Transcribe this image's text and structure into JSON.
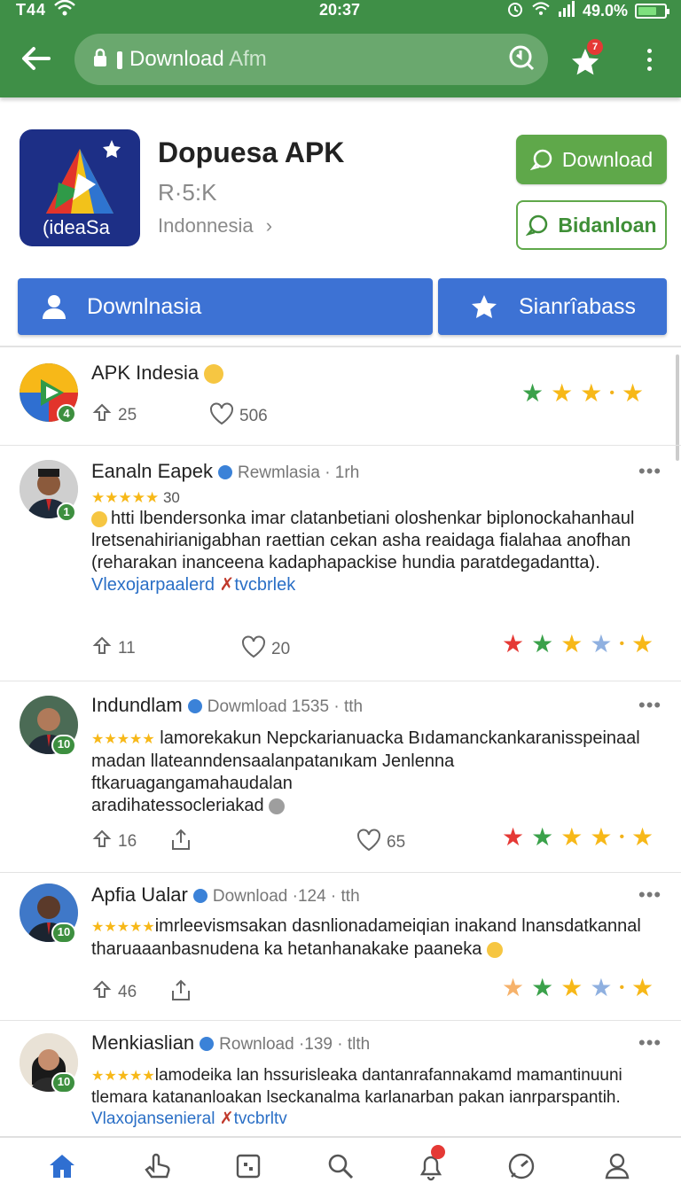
{
  "status": {
    "carrier": "T44",
    "time": "20:37",
    "battery": "49.0%"
  },
  "browser": {
    "url_main": "Download",
    "url_dim": " Afm",
    "notification_badge": "7"
  },
  "app": {
    "name": "Dopuesa APK",
    "size": "R·5:K",
    "region": "Indonnesia",
    "icon_text": "(ideaSa",
    "download_label": "Download",
    "secondary_label": "Bidanloan"
  },
  "actions": {
    "primary_label": "Downlnasia",
    "secondary_label": "Sianrîabass"
  },
  "feed": {
    "top": {
      "title": "APK Indesia",
      "shares": "25",
      "likes": "506",
      "level": "4"
    },
    "posts": [
      {
        "name": "Eanaln Eapek",
        "meta": "Rewmlasia · 1rh",
        "stars_text": "★★★★★",
        "rating_count": "30",
        "lines": [
          "htti lbendersonka imar clatanbetiani oloshenkar biplonockahanhaul",
          "lretsenahirianigabhan raettian cekan asha reaidaga fialahaa anofhan",
          "(reharakan inanceena kadaphapackise hundia paratdegadantta)."
        ],
        "link": "Vlexojarpaalerd",
        "tag": "tvcbrlek",
        "shares": "11",
        "likes": "20",
        "level": "1"
      },
      {
        "name": "Indundlam",
        "meta": "Dowmload 1535 · tth",
        "stars_text": "★★★★★",
        "lines": [
          "lamorekakun Nepckarianuacka Bıdamanckankaranisspeinaal",
          "madan llateanndensaalanpatanıkam Jenlenna ftkaruagangamahaudalan",
          "aradihatessocleriakad"
        ],
        "shares": "16",
        "likes": "65",
        "level": "10"
      },
      {
        "name": "Apfia Ualar",
        "meta": "Download ·124 · tth",
        "stars_text": "★★★★★",
        "lines": [
          "imrleevismsakan dasnlionadameiqian inakand lnansdatkannal",
          "tharuaaanbasnudena ka hetanhanakake paaneka"
        ],
        "shares": "46",
        "level": "10"
      },
      {
        "name": "Menkiaslian",
        "meta": "Rownload ·139 · tlth",
        "stars_text": "★★★★★",
        "lines": [
          "lamodeika lan hssurisleaka dantanrafannakamd mamantinuuni",
          "tlemara katananloakan lseckanalma karlanarban pakan ianrparspantih."
        ],
        "link": "Vlaxojansenieral",
        "tag": "tvcbrltv",
        "level": "10"
      }
    ]
  },
  "colors": {
    "brand": "#3f8f47",
    "button_blue": "#3d72d4",
    "button_green": "#5fa84a"
  }
}
